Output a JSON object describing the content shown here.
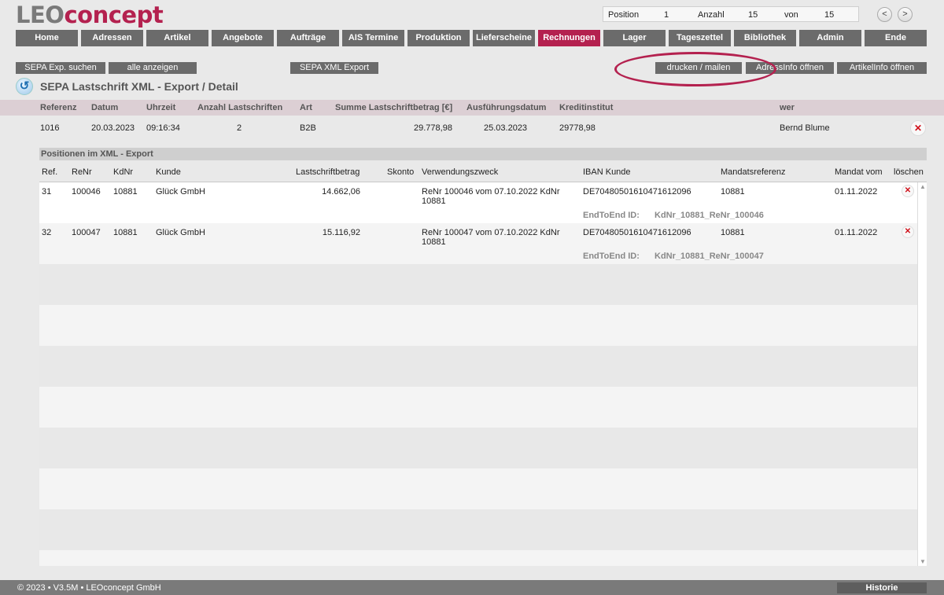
{
  "logo": {
    "leo": "LEO",
    "concept": "concept"
  },
  "position_bar": {
    "position_label": "Position",
    "position_value": "1",
    "anzahl_label": "Anzahl",
    "anzahl_value": "15",
    "von_label": "von",
    "von_value": "15",
    "prev": "<",
    "next": ">"
  },
  "nav": [
    "Home",
    "Adressen",
    "Artikel",
    "Angebote",
    "Aufträge",
    "AIS Termine",
    "Produktion",
    "Lieferscheine",
    "Rechnungen",
    "Lager",
    "Tageszettel",
    "Bibliothek",
    "Admin",
    "Ende"
  ],
  "nav_active": "Rechnungen",
  "toolbar": {
    "sepa_suchen": "SEPA Exp. suchen",
    "alle_anzeigen": "alle anzeigen",
    "sepa_xml_export": "SEPA XML Export",
    "drucken_mailen": "drucken / mailen",
    "adressinfo": "AdressInfo öffnen",
    "artikelinfo": "ArtikelInfo öffnen"
  },
  "page_title": "SEPA Lastschrift XML - Export / Detail",
  "summary": {
    "headers": {
      "referenz": "Referenz",
      "datum": "Datum",
      "uhrzeit": "Uhrzeit",
      "anzahl": "Anzahl Lastschriften",
      "art": "Art",
      "summe": "Summe Lastschriftbetrag [€]",
      "ausfuehrung": "Ausführungsdatum",
      "kreditinstitut": "Kreditinstitut",
      "wer": "wer"
    },
    "row": {
      "referenz": "1016",
      "datum": "20.03.2023",
      "uhrzeit": "09:16:34",
      "anzahl": "2",
      "art": "B2B",
      "summe": "29.778,98",
      "ausfuehrung": "25.03.2023",
      "kreditinstitut": "29778,98",
      "wer": "Bernd Blume"
    }
  },
  "positions": {
    "title": "Positionen im XML - Export",
    "headers": {
      "ref": "Ref.",
      "renr": "ReNr",
      "kdnr": "KdNr",
      "kunde": "Kunde",
      "betrag": "Lastschriftbetrag",
      "skonto": "Skonto",
      "zweck": "Verwendungszweck",
      "iban": "IBAN Kunde",
      "mandatsref": "Mandatsreferenz",
      "mandat_vom": "Mandat vom",
      "loeschen": "löschen"
    },
    "e2e_label": "EndToEnd ID:",
    "rows": [
      {
        "ref": "31",
        "renr": "100046",
        "kdnr": "10881",
        "kunde": "Glück GmbH",
        "betrag": "14.662,06",
        "zweck": "ReNr 100046 vom 07.10.2022 KdNr 10881",
        "iban": "DE70480501610471612096",
        "mandatsref": "10881",
        "mandat_vom": "01.11.2022",
        "e2e": "KdNr_10881_ReNr_100046"
      },
      {
        "ref": "32",
        "renr": "100047",
        "kdnr": "10881",
        "kunde": "Glück GmbH",
        "betrag": "15.116,92",
        "zweck": "ReNr 100047 vom 07.10.2022 KdNr 10881",
        "iban": "DE70480501610471612096",
        "mandatsref": "10881",
        "mandat_vom": "01.11.2022",
        "e2e": "KdNr_10881_ReNr_100047"
      }
    ]
  },
  "footer": {
    "copyright": "© 2023 • V3.5M • LEOconcept GmbH",
    "historie": "Historie"
  },
  "colors": {
    "accent": "#b4214f",
    "nav": "#6b6b6b",
    "summary_bg": "#dccfd4"
  }
}
